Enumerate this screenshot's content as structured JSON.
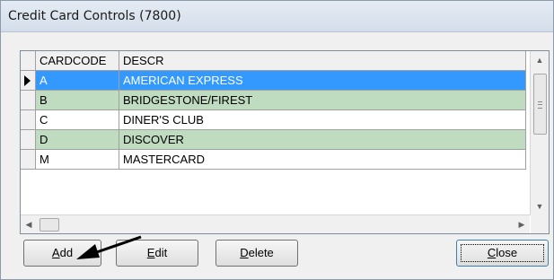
{
  "window": {
    "title": "Credit Card Controls (7800)"
  },
  "grid": {
    "columns": [
      "CARDCODE",
      "DESCR"
    ],
    "rows": [
      {
        "code": "A",
        "descr": "AMERICAN EXPRESS",
        "state": "selected"
      },
      {
        "code": "B",
        "descr": "BRIDGESTONE/FIREST",
        "state": "green"
      },
      {
        "code": "C",
        "descr": "DINER'S CLUB",
        "state": "white"
      },
      {
        "code": "D",
        "descr": "DISCOVER",
        "state": "green"
      },
      {
        "code": "M",
        "descr": "MASTERCARD",
        "state": "white"
      }
    ]
  },
  "buttons": {
    "add": {
      "mnemonic": "A",
      "rest": "dd"
    },
    "edit": {
      "mnemonic": "E",
      "rest": "dit"
    },
    "delete": {
      "mnemonic": "D",
      "rest": "elete"
    },
    "close": {
      "mnemonic": "C",
      "rest": "lose"
    }
  },
  "colors": {
    "selected_row": "#3399ff",
    "alt_row": "#c0dcc0",
    "annotation_arrow": "#000000"
  }
}
